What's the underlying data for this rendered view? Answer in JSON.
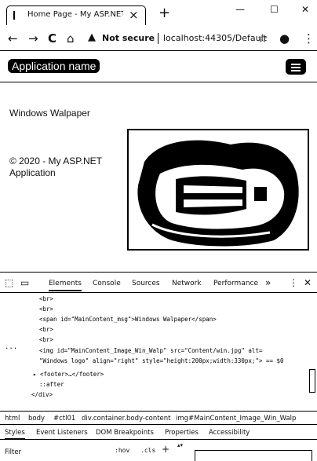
{
  "browser": {
    "tab": {
      "title": "Home Page - My ASP.NET Appli",
      "close": "×"
    },
    "new_tab": "+",
    "window_controls": {
      "minimize": "—",
      "maximize": "☐",
      "close": "✕"
    },
    "nav": {
      "back": "←",
      "forward": "→",
      "reload": "C",
      "home": "⌂"
    },
    "address": {
      "security_icon": "▲",
      "security_text": "Not secure",
      "url": "localhost:44305/Default"
    },
    "actions": {
      "star": "☆",
      "profile": "●",
      "menu": "⋮"
    }
  },
  "page": {
    "brand": "Application name",
    "message": "Windows Walpaper",
    "footer": "© 2020 - My ASP.NET Application",
    "image": {
      "alt": "Windows logo",
      "src": "Content/win.jpg"
    }
  },
  "devtools": {
    "icons": {
      "inspect": "⬚",
      "device": "▭",
      "more": "»",
      "menu": "⋮",
      "close": "✕"
    },
    "tabs": [
      "Elements",
      "Console",
      "Sources",
      "Network",
      "Performance"
    ],
    "active_tab": "Elements",
    "dom_lines": [
      "<br>",
      "<br>",
      "<span id=\"MainContent_msg\">Windows Walpaper</span>",
      "<br>",
      "<br>",
      "<img id=\"MainContent_Image_Win_Walp\" src=\"Content/win.jpg\" alt=",
      "\"Windows logo\" align=\"right\" style=\"height:200px;width:330px;\"> == $0",
      "▸ <footer>…</footer>",
      "::after",
      "</div>"
    ],
    "dom_ellipsis": "...",
    "breadcrumbs": [
      "html",
      "body",
      "#ctl01",
      "div.container.body-content",
      "img#MainContent_Image_Win_Walp"
    ],
    "subtabs": [
      "Styles",
      "Event Listeners",
      "DOM Breakpoints",
      "Properties",
      "Accessibility"
    ],
    "filter": {
      "label": "Filter",
      "hov": ":hov",
      "cls": ".cls",
      "add": "+",
      "spin": "▴▾"
    }
  }
}
